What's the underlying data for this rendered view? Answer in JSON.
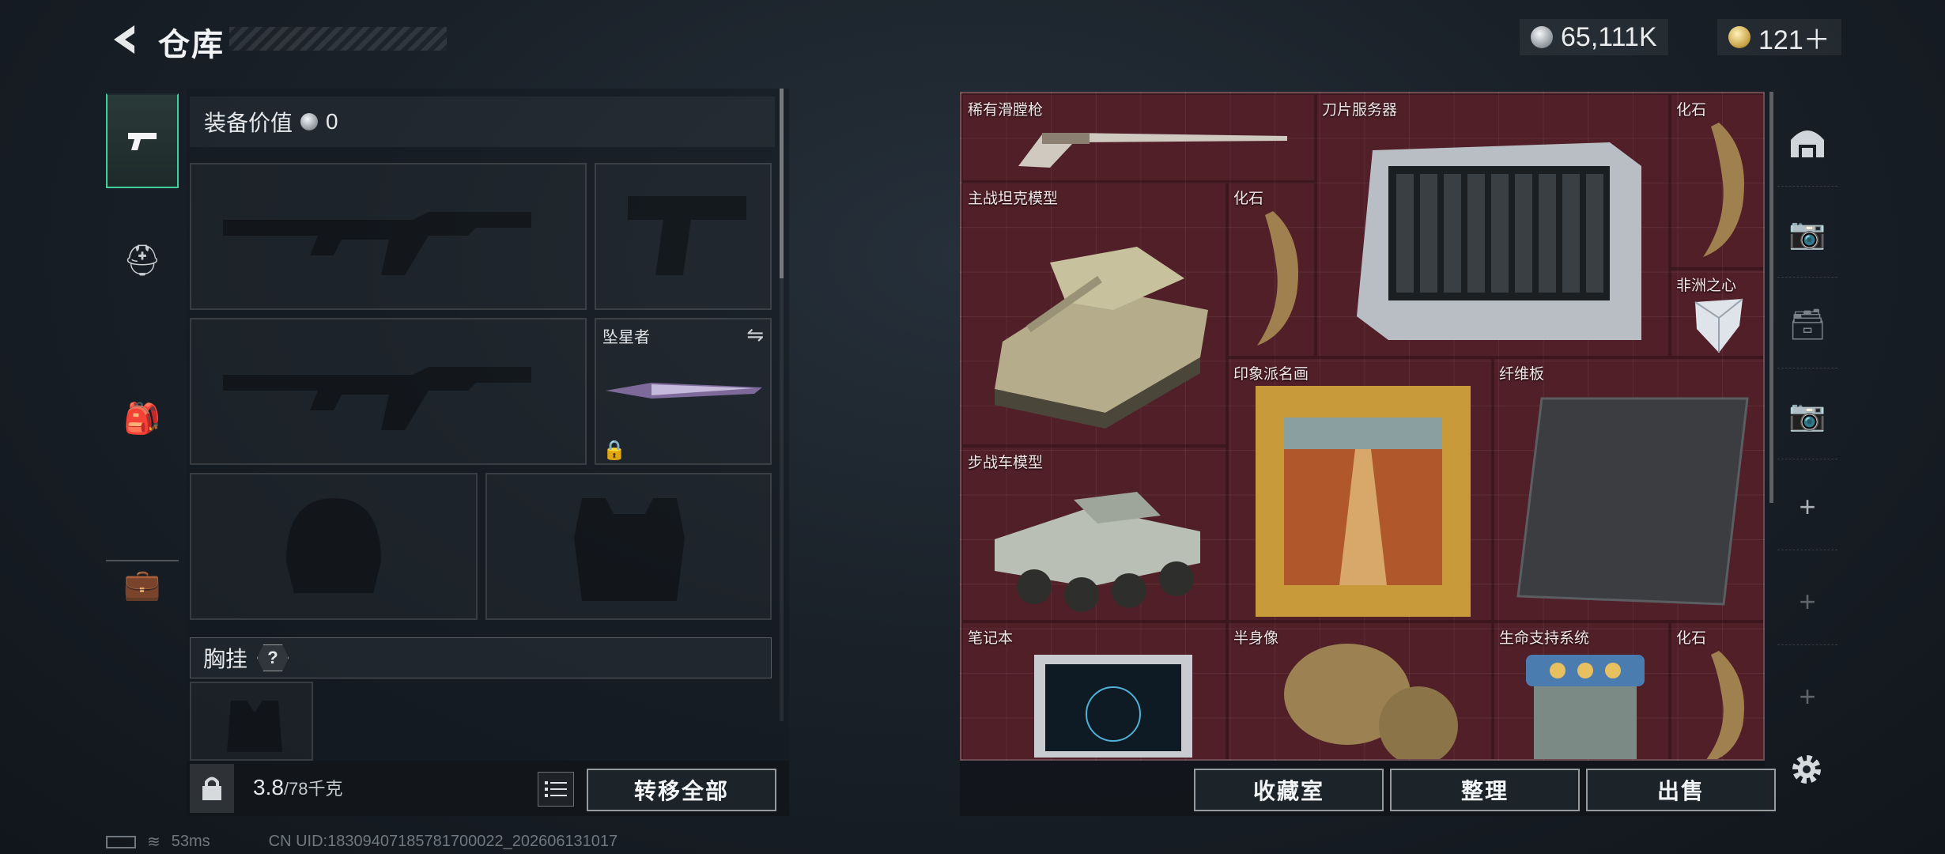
{
  "header": {
    "title": "仓库"
  },
  "currencies": [
    {
      "value": "65,111K",
      "icon": "silver-coin-icon"
    },
    {
      "value": "121＋",
      "icon": "gold-coin-icon"
    }
  ],
  "equipment": {
    "value_label": "装备价值",
    "value": "0",
    "melee_slot_label": "坠星者",
    "chest_label": "胸挂",
    "help": "?"
  },
  "footer_left": {
    "weight_current": "3.8",
    "weight_max": "/78千克",
    "transfer_all": "转移全部"
  },
  "storage": {
    "items": [
      {
        "label": "稀有滑膛枪"
      },
      {
        "label": "刀片服务器"
      },
      {
        "label": "化石"
      },
      {
        "label": "主战坦克模型"
      },
      {
        "label": "化石"
      },
      {
        "label": "非洲之心"
      },
      {
        "label": "印象派名画"
      },
      {
        "label": "纤维板"
      },
      {
        "label": "步战车模型"
      },
      {
        "label": "笔记本"
      },
      {
        "label": "半身像"
      },
      {
        "label": "生命支持系统"
      },
      {
        "label": "化石"
      }
    ],
    "buttons": {
      "collection": "收藏室",
      "sort": "整理",
      "sell": "出售"
    }
  },
  "status": {
    "ping": "53ms",
    "uid": "CN UID:18309407185781700022_202606131017"
  },
  "colors": {
    "active_accent": "#3ecf9a",
    "storage_bg": "#4c1e26"
  }
}
